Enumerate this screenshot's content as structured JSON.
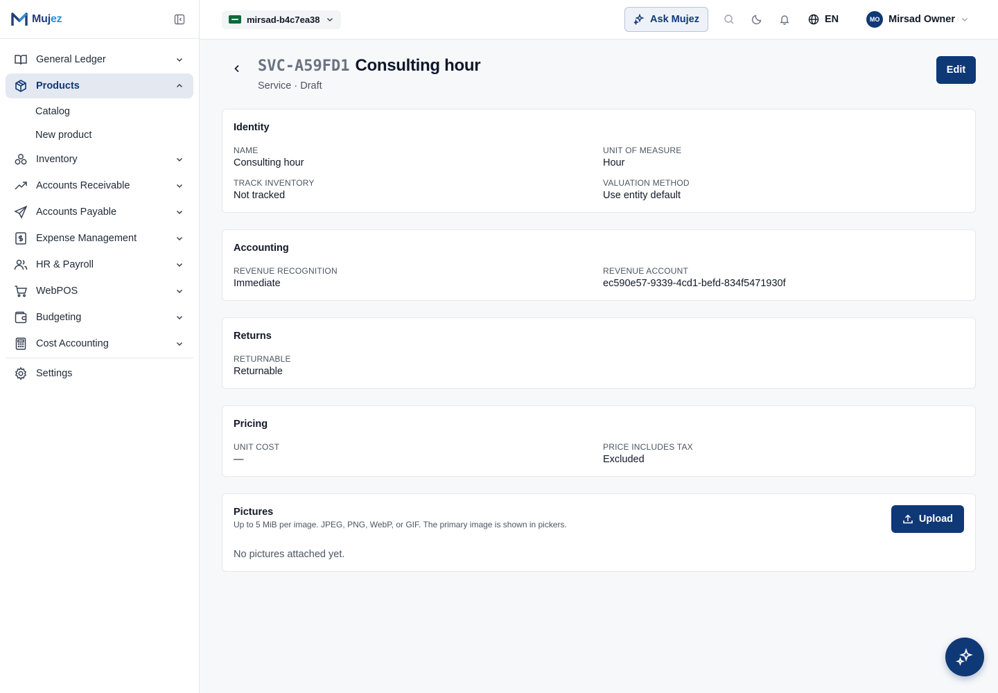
{
  "brand": {
    "name_main": "Muj",
    "name_accent": "ez"
  },
  "sidebar": {
    "items": [
      {
        "label": "General Ledger",
        "icon": "book-open-icon"
      },
      {
        "label": "Products",
        "icon": "package-icon",
        "active": true,
        "expanded": true,
        "children": [
          {
            "label": "Catalog"
          },
          {
            "label": "New product"
          }
        ]
      },
      {
        "label": "Inventory",
        "icon": "boxes-icon"
      },
      {
        "label": "Accounts Receivable",
        "icon": "trending-up-icon"
      },
      {
        "label": "Accounts Payable",
        "icon": "send-icon"
      },
      {
        "label": "Expense Management",
        "icon": "receipt-icon"
      },
      {
        "label": "HR & Payroll",
        "icon": "users-icon"
      },
      {
        "label": "WebPOS",
        "icon": "cart-icon"
      },
      {
        "label": "Budgeting",
        "icon": "wallet-icon"
      },
      {
        "label": "Cost Accounting",
        "icon": "calculator-icon"
      }
    ],
    "settings_label": "Settings"
  },
  "topbar": {
    "entity": "mirsad-b4c7ea38",
    "ask_label": "Ask Mujez",
    "language": "EN",
    "user_initials": "MO",
    "user_name": "Mirsad Owner"
  },
  "page": {
    "code": "SVC-A59FD1",
    "name": "Consulting hour",
    "subtitle": "Service · Draft",
    "edit_label": "Edit"
  },
  "identity": {
    "title": "Identity",
    "name_label": "NAME",
    "name_value": "Consulting hour",
    "uom_label": "UNIT OF MEASURE",
    "uom_value": "Hour",
    "track_label": "TRACK INVENTORY",
    "track_value": "Not tracked",
    "valuation_label": "VALUATION METHOD",
    "valuation_value": "Use entity default"
  },
  "accounting": {
    "title": "Accounting",
    "recog_label": "REVENUE RECOGNITION",
    "recog_value": "Immediate",
    "account_label": "REVENUE ACCOUNT",
    "account_value": "ec590e57-9339-4cd1-befd-834f5471930f"
  },
  "returns": {
    "title": "Returns",
    "returnable_label": "RETURNABLE",
    "returnable_value": "Returnable"
  },
  "pricing": {
    "title": "Pricing",
    "cost_label": "UNIT COST",
    "cost_value": "—",
    "tax_label": "PRICE INCLUDES TAX",
    "tax_value": "Excluded"
  },
  "pictures": {
    "title": "Pictures",
    "description": "Up to 5 MiB per image. JPEG, PNG, WebP, or GIF. The primary image is shown in pickers.",
    "empty": "No pictures attached yet.",
    "upload_label": "Upload"
  },
  "colors": {
    "primary": "#0f3876",
    "active_bg": "#e3e8f1",
    "brand_accent": "#2b8fd6"
  }
}
